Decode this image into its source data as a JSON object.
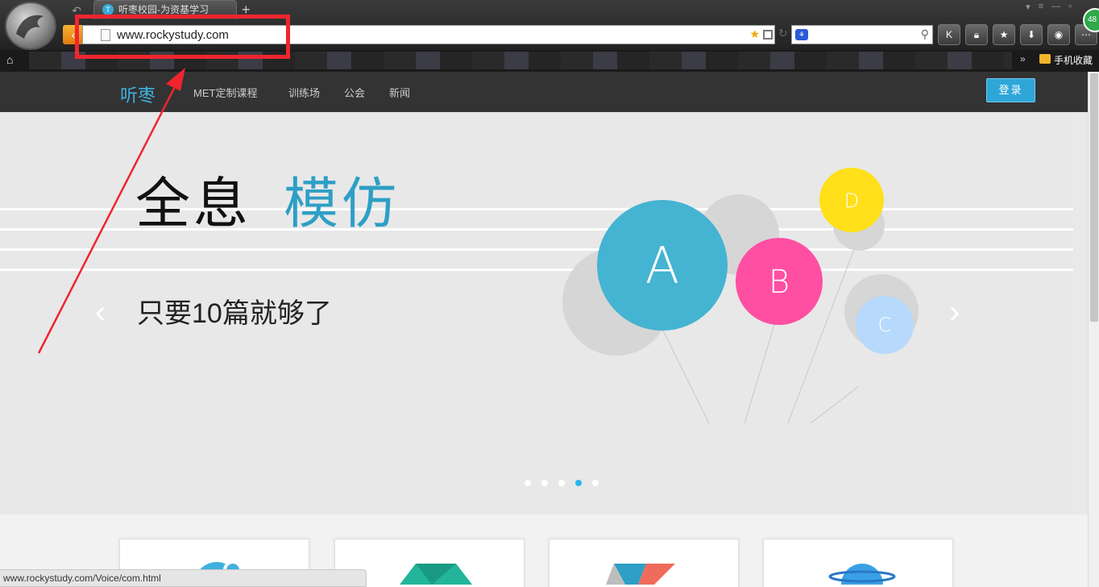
{
  "browser": {
    "tab_title": "听枣校园-为资基学习",
    "tab_favicon_letter": "T",
    "url": "www.rockystudy.com",
    "extension_badge": "48",
    "status_url": "www.rockystudy.com/Voice/com.html",
    "bookmark_folder": "手机收藏",
    "icons": [
      "browser-logo-icon",
      "back-icon",
      "new-tab-icon",
      "page-icon",
      "star-icon",
      "qr-icon",
      "reload-icon",
      "search-engine-icon",
      "search-icon",
      "k-icon",
      "lock-icon",
      "favorites-icon",
      "download-icon",
      "gamepad-icon",
      "more-icon",
      "home-icon",
      "folder-icon"
    ]
  },
  "site": {
    "logo": "听枣",
    "nav": [
      "MET定制课程",
      "训练场",
      "公会",
      "新闻"
    ],
    "login": "登录"
  },
  "hero": {
    "title_black": "全息",
    "title_blue": "模仿",
    "subtitle": "只要10篇就够了",
    "balloons": [
      {
        "letter": "A",
        "color": "#45b3d2"
      },
      {
        "letter": "B",
        "color": "#ff4fa3"
      },
      {
        "letter": "D",
        "color": "#ffe01a"
      },
      {
        "letter": "C",
        "color": "#b7d9fb"
      }
    ],
    "carousel_total": 5,
    "carousel_active": 4
  },
  "colors": {
    "accent": "#2ea6d8",
    "annotation": "#f0252d"
  }
}
